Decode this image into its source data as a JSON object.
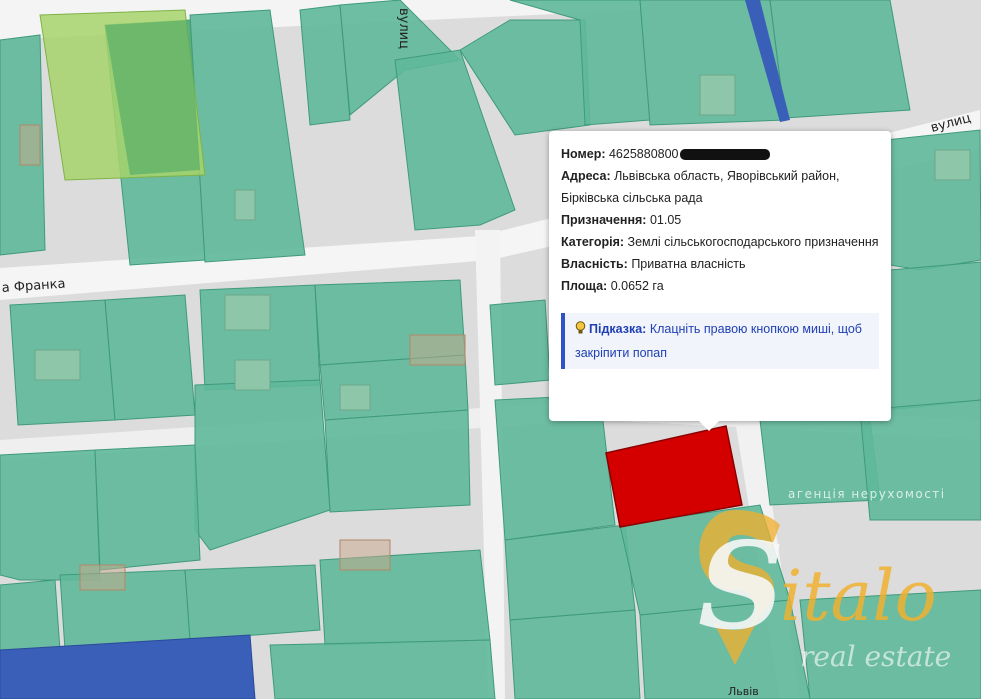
{
  "map": {
    "streets": {
      "franka": "а Франка",
      "vulytsia_top_right": "вулиц",
      "vulytsia_vertical": "вулиц",
      "lviv_bottom": "Львів"
    },
    "colors": {
      "parcel": "#5fb89a",
      "parcel_border": "#3f9a7c",
      "road": "#f4f4f4",
      "background": "#d9d9d9",
      "selected_parcel": "#d40000",
      "water": "#3a5fb8",
      "green_zone": "#a6d46a"
    }
  },
  "popup": {
    "nomer_label": "Номер:",
    "nomer_value": "4625880800",
    "adresa_label": "Адреса:",
    "adresa_value": "Львівська область, Яворівський район, Бірківська сільська рада",
    "pryznachennia_label": "Призначення:",
    "pryznachennia_value": "01.05",
    "katehoriia_label": "Категорія:",
    "katehoriia_value": "Землі сільськогосподарського призначення",
    "vlasnist_label": "Власність:",
    "vlasnist_value": "Приватна власність",
    "ploshcha_label": "Площа:",
    "ploshcha_value": "0.0652 га",
    "hint_label": "Підказка:",
    "hint_text": "Клацніть правою кнопкою миші, щоб закріпити попап"
  },
  "watermark": {
    "letter": "S",
    "brand": "italo",
    "top_text": "агенція нерухомості",
    "bottom_text": "real estate"
  }
}
